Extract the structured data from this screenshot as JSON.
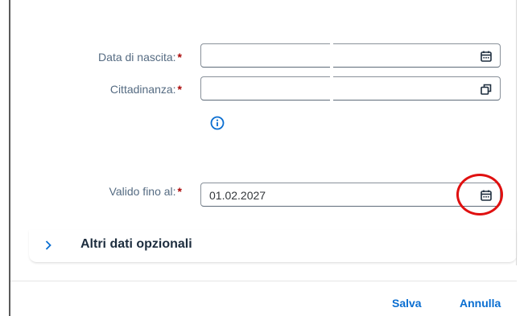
{
  "form": {
    "birth_date": {
      "label": "Data di nascita:",
      "required": "*",
      "value": ""
    },
    "citizenship": {
      "label": "Cittadinanza:",
      "required": "*",
      "value": ""
    },
    "valid_until": {
      "label": "Valido fino al:",
      "required": "*",
      "value": "01.02.2027"
    }
  },
  "panel": {
    "title": "Altri dati opzionali"
  },
  "footer": {
    "save_label": "Salva",
    "cancel_label": "Annulla"
  },
  "icons": {
    "calendar": "calendar-icon",
    "value_help": "value-help-icon",
    "info": "info-icon",
    "chevron": "chevron-right-icon"
  },
  "colors": {
    "accent": "#0a6ed1",
    "required": "#aa0808",
    "highlight": "#e01010"
  }
}
